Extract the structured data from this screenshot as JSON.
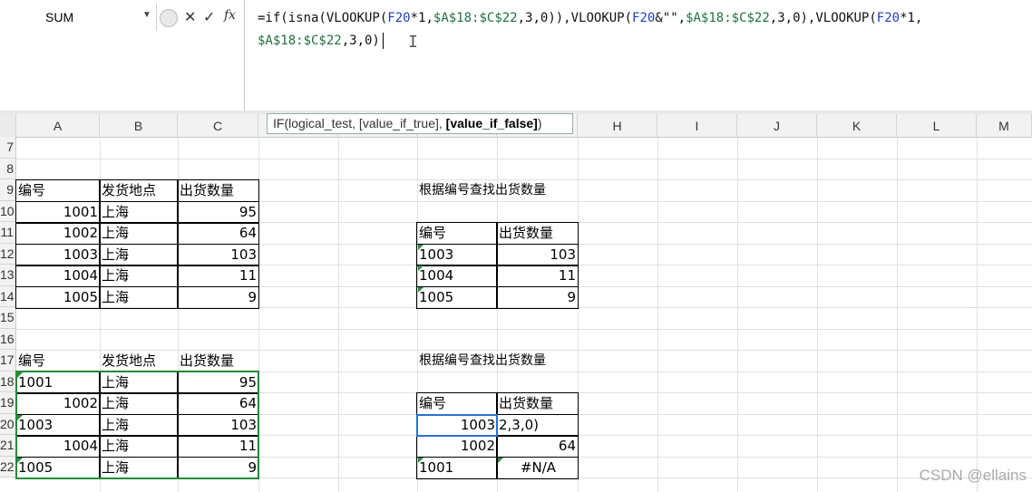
{
  "namebox": {
    "value": "SUM"
  },
  "formula_bar": {
    "line1_parts": [
      {
        "t": "=if(isna(VLOOKUP(",
        "c": ""
      },
      {
        "t": "F20",
        "c": "blue"
      },
      {
        "t": "*1,",
        "c": ""
      },
      {
        "t": "$A$18:$C$22",
        "c": "green"
      },
      {
        "t": ",3,0)),VLOOKUP(",
        "c": ""
      },
      {
        "t": "F20",
        "c": "blue"
      },
      {
        "t": "&\"\",",
        "c": ""
      },
      {
        "t": "$A$18:$C$22",
        "c": "green"
      },
      {
        "t": ",3,0),VLOOKUP(",
        "c": ""
      },
      {
        "t": "F20",
        "c": "blue"
      },
      {
        "t": "*1,",
        "c": ""
      }
    ],
    "line2_parts": [
      {
        "t": "$A$18:$C$22",
        "c": "green"
      },
      {
        "t": ",3,0)",
        "c": ""
      }
    ]
  },
  "tooltip": {
    "prefix": "IF(logical_test, [value_if_true], ",
    "bold": "[value_if_false]",
    "suffix": ")"
  },
  "columns": [
    "A",
    "B",
    "C",
    "",
    "",
    "",
    "",
    "H",
    "I",
    "J",
    "K",
    "L",
    "M"
  ],
  "rows": [
    "7",
    "8",
    "9",
    "10",
    "11",
    "12",
    "13",
    "14",
    "15",
    "16",
    "17",
    "18",
    "19",
    "20",
    "21",
    "22"
  ],
  "table1": {
    "headers": [
      "编号",
      "发货地点",
      "出货数量"
    ],
    "rows": [
      [
        "1001",
        "上海",
        "95"
      ],
      [
        "1002",
        "上海",
        "64"
      ],
      [
        "1003",
        "上海",
        "103"
      ],
      [
        "1004",
        "上海",
        "11"
      ],
      [
        "1005",
        "上海",
        "9"
      ]
    ]
  },
  "lookup1": {
    "title": "根据编号查找出货数量",
    "headers": [
      "编号",
      "出货数量"
    ],
    "rows": [
      [
        "1003",
        "103"
      ],
      [
        "1004",
        "11"
      ],
      [
        "1005",
        "9"
      ]
    ]
  },
  "table2": {
    "headers": [
      "编号",
      "发货地点",
      "出货数量"
    ],
    "rows": [
      [
        "1001",
        "上海",
        "95"
      ],
      [
        "1002",
        "上海",
        "64"
      ],
      [
        "1003",
        "上海",
        "103"
      ],
      [
        "1004",
        "上海",
        "11"
      ],
      [
        "1005",
        "上海",
        "9"
      ]
    ]
  },
  "lookup2": {
    "title": "根据编号查找出货数量",
    "headers": [
      "编号",
      "出货数量"
    ],
    "rows": [
      [
        "1003",
        "2,3,0)"
      ],
      [
        "1002",
        "64"
      ],
      [
        "1001",
        "#N/A"
      ]
    ]
  },
  "watermark": "CSDN @ellains"
}
